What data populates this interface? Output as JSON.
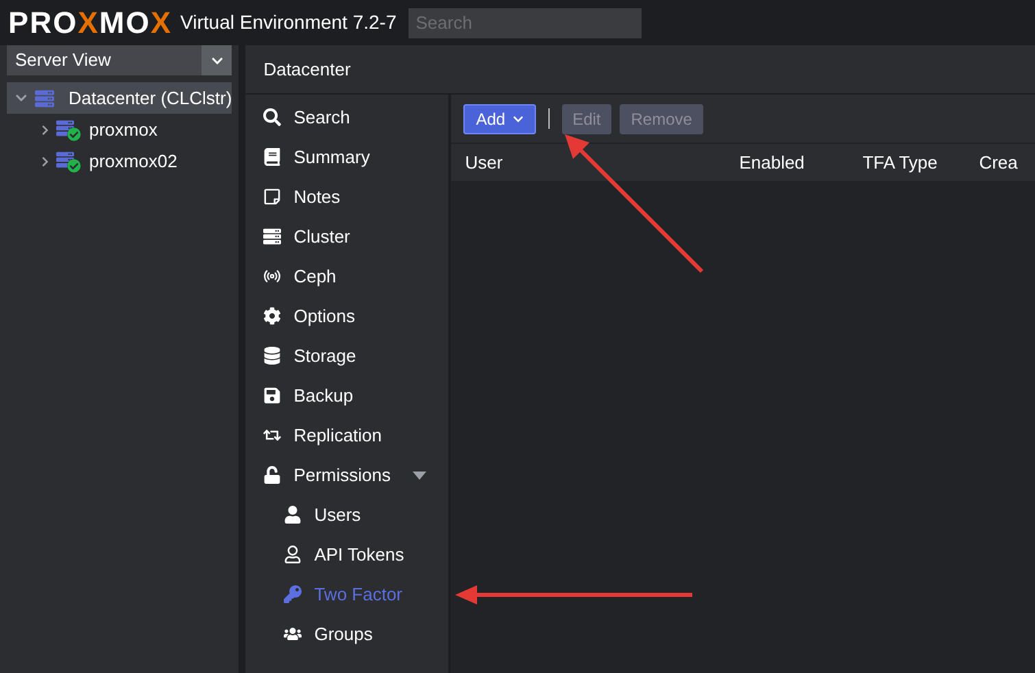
{
  "header": {
    "logo": "PROXMOX",
    "product": "Virtual Environment 7.2-7",
    "search": {
      "placeholder": "Search"
    }
  },
  "sidebar": {
    "view_select": "Server View",
    "tree": [
      {
        "label": "Datacenter (CLClstr)",
        "expanded": true,
        "selected": true,
        "children": [
          {
            "label": "proxmox",
            "expanded": false,
            "selected": false
          },
          {
            "label": "proxmox02",
            "expanded": false,
            "selected": false
          }
        ]
      }
    ]
  },
  "panel": {
    "title": "Datacenter",
    "nav": [
      {
        "label": "Search",
        "selected": false
      },
      {
        "label": "Summary",
        "selected": false
      },
      {
        "label": "Notes",
        "selected": false
      },
      {
        "label": "Cluster",
        "selected": false
      },
      {
        "label": "Ceph",
        "selected": false
      },
      {
        "label": "Options",
        "selected": false
      },
      {
        "label": "Storage",
        "selected": false
      },
      {
        "label": "Backup",
        "selected": false
      },
      {
        "label": "Replication",
        "selected": false
      },
      {
        "label": "Permissions",
        "selected": false,
        "expanded": true,
        "children": [
          {
            "label": "Users",
            "selected": false
          },
          {
            "label": "API Tokens",
            "selected": false
          },
          {
            "label": "Two Factor",
            "selected": true
          },
          {
            "label": "Groups",
            "selected": false
          }
        ]
      }
    ]
  },
  "toolbar": [
    {
      "label": "Add",
      "disabled": false,
      "kind": "menu"
    },
    {
      "label": "Edit",
      "disabled": true,
      "kind": "plain"
    },
    {
      "label": "Remove",
      "disabled": true,
      "kind": "plain"
    }
  ],
  "table": {
    "columns": [
      "User",
      "Enabled",
      "TFA Type",
      "Crea"
    ]
  }
}
